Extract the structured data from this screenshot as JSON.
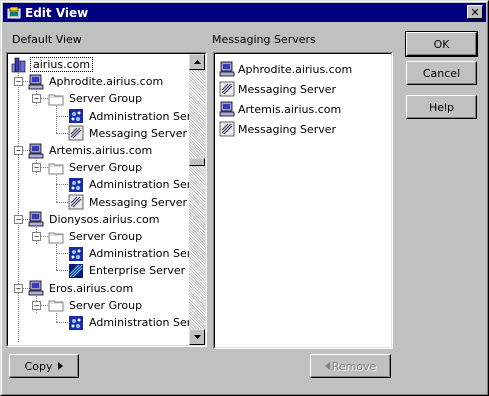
{
  "window": {
    "title": "Edit View",
    "close_glyph": "✕"
  },
  "left_panel": {
    "label": "Default View",
    "root": "airius.com",
    "hosts": [
      {
        "name": "Aphrodite.airius.com",
        "group": "Server Group",
        "servers": [
          {
            "name": "Administration Server",
            "icon": "admin-server-icon"
          },
          {
            "name": "Messaging Server",
            "icon": "messaging-server-icon"
          }
        ]
      },
      {
        "name": "Artemis.airius.com",
        "group": "Server Group",
        "servers": [
          {
            "name": "Administration Server",
            "icon": "admin-server-icon"
          },
          {
            "name": "Messaging Server",
            "icon": "messaging-server-icon"
          }
        ]
      },
      {
        "name": "Dionysos.airius.com",
        "group": "Server Group",
        "servers": [
          {
            "name": "Administration Server",
            "icon": "admin-server-icon"
          },
          {
            "name": "Enterprise Server",
            "icon": "enterprise-server-icon"
          }
        ]
      },
      {
        "name": "Eros.airius.com",
        "group": "Server Group",
        "servers": [
          {
            "name": "Administration Server",
            "icon": "admin-server-icon"
          }
        ]
      }
    ]
  },
  "right_panel": {
    "label": "Messaging Servers",
    "items": [
      {
        "name": "Aphrodite.airius.com",
        "icon": "host-computer-icon"
      },
      {
        "name": "Messaging Server",
        "icon": "messaging-server-icon"
      },
      {
        "name": "Artemis.airius.com",
        "icon": "host-computer-icon"
      },
      {
        "name": "Messaging Server",
        "icon": "messaging-server-icon"
      }
    ]
  },
  "buttons": {
    "ok": "OK",
    "cancel": "Cancel",
    "help": "Help",
    "copy": "Copy",
    "remove": "Remove"
  },
  "colors": {
    "titlebar": "#000080",
    "face": "#c0c0c0",
    "host_icon_blue": "#3a3ab8",
    "admin_icon_blue": "#1a2aa8"
  }
}
